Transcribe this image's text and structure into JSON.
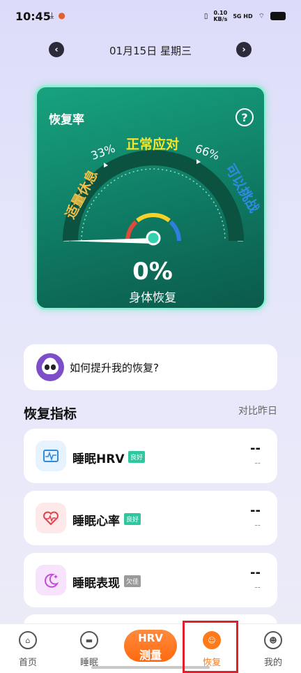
{
  "status_bar": {
    "time": "10:45",
    "speed_top": "0.10",
    "speed_unit": "KB/s",
    "network": "5G HD"
  },
  "date_nav": {
    "date": "01月15日 星期三",
    "prev_icon": "chevron-left-icon",
    "next_icon": "chevron-right-icon"
  },
  "recovery": {
    "title": "恢复率",
    "help_icon": "question-icon",
    "gauge": {
      "value_percent": 0,
      "zones": [
        {
          "label": "适量休息",
          "color": "#f0c04a"
        },
        {
          "label": "正常应对",
          "color": "#f5e62a"
        },
        {
          "label": "可以挑战",
          "color": "#2f8be0"
        }
      ],
      "marks": [
        "33%",
        "66%"
      ]
    },
    "value": "0%",
    "subtitle": "身体恢复"
  },
  "tip": {
    "text": "如何提升我的恢复?",
    "avatar_icon": "panda-avatar-icon"
  },
  "metrics_section": {
    "title": "恢复指标",
    "compare_label": "对比昨日"
  },
  "metrics": [
    {
      "label": "睡眠HRV",
      "badge": "良好",
      "badge_color": "#2fc7a0",
      "value": "--",
      "sub": "--",
      "icon": "hrv-wave-icon",
      "icon_bg": "#e6f2fd",
      "icon_color": "#2f8be0"
    },
    {
      "label": "睡眠心率",
      "badge": "良好",
      "badge_color": "#2fc7a0",
      "value": "--",
      "sub": "--",
      "icon": "heart-pulse-icon",
      "icon_bg": "#fde9ea",
      "icon_color": "#e0404a"
    },
    {
      "label": "睡眠表现",
      "badge": "欠佳",
      "badge_color": "#9a9a9a",
      "value": "--",
      "sub": "--",
      "icon": "moon-stars-icon",
      "icon_bg": "#f7e3fb",
      "icon_color": "#c34ad9"
    }
  ],
  "bottom_nav": {
    "items": [
      {
        "label": "首页",
        "icon": "home-icon"
      },
      {
        "label": "睡眠",
        "icon": "bed-icon"
      },
      {
        "label": "恢复",
        "icon": "sun-smile-icon"
      },
      {
        "label": "我的",
        "icon": "profile-icon"
      }
    ],
    "hrv_line1": "HRV",
    "hrv_line2": "测量",
    "active": "恢复",
    "accent": "#ff7a1a"
  }
}
